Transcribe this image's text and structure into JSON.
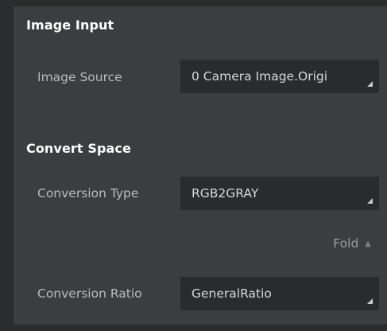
{
  "sections": {
    "image_input": {
      "title": "Image Input",
      "image_source_label": "Image Source",
      "image_source_value": "0 Camera Image.Origi"
    },
    "convert_space": {
      "title": "Convert Space",
      "conversion_type_label": "Conversion Type",
      "conversion_type_value": "RGB2GRAY",
      "fold_label": "Fold",
      "fold_icon": "triangle-up-icon",
      "conversion_ratio_label": "Conversion Ratio",
      "conversion_ratio_value": "GeneralRatio"
    }
  },
  "colors": {
    "panel_bg": "#3c3d40",
    "field_bg": "#2a2b2e",
    "outer_bg": "#2b2c2e"
  }
}
